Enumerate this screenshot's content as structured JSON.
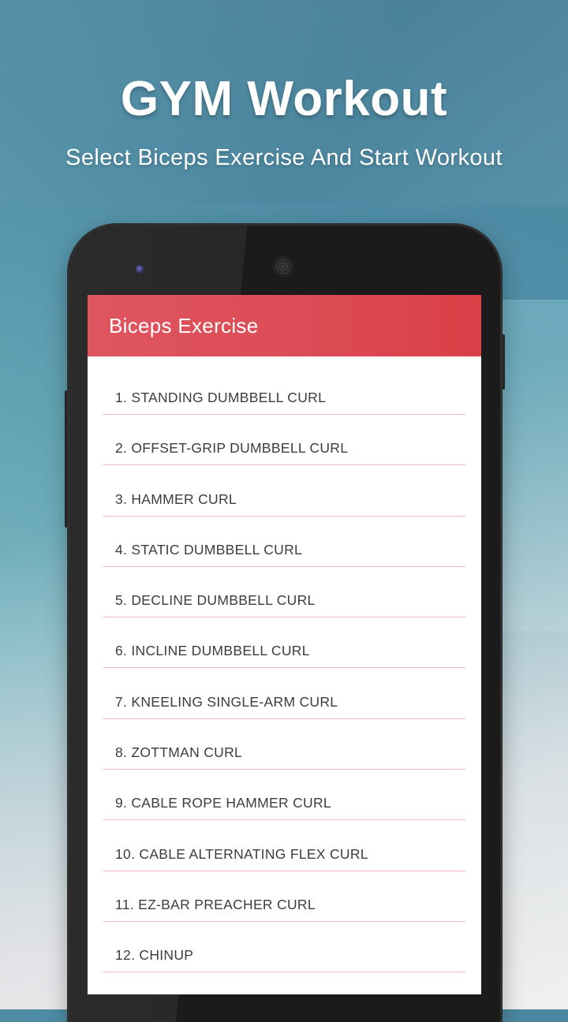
{
  "promo": {
    "title": "GYM Workout",
    "subtitle": "Select Biceps Exercise And Start Workout"
  },
  "app": {
    "toolbar_title": "Biceps Exercise",
    "accent_color": "#dc4c56",
    "divider_color": "#f2b9bc",
    "exercises": [
      "1. STANDING DUMBBELL CURL",
      "2. OFFSET-GRIP DUMBBELL CURL",
      "3. HAMMER CURL",
      "4. STATIC DUMBBELL CURL",
      "5. DECLINE DUMBBELL CURL",
      "6. INCLINE DUMBBELL CURL",
      "7. KNEELING SINGLE-ARM CURL",
      "8. ZOTTMAN CURL",
      "9. CABLE ROPE HAMMER CURL",
      "10. CABLE ALTERNATING FLEX CURL",
      "11. EZ-BAR PREACHER CURL",
      "12. CHINUP"
    ]
  }
}
